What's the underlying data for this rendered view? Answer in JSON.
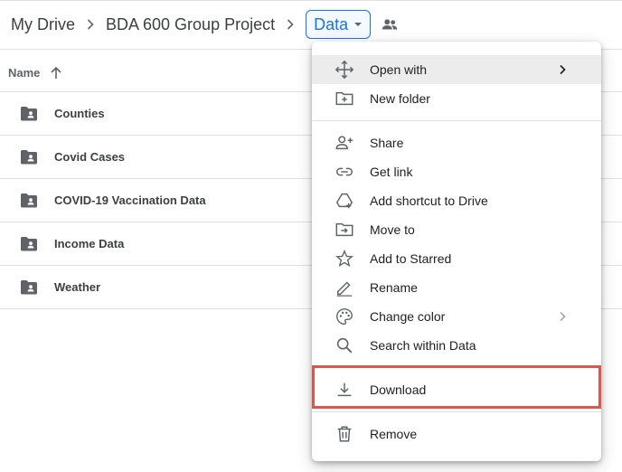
{
  "breadcrumb": {
    "root": "My Drive",
    "parent": "BDA 600 Group Project",
    "current": "Data"
  },
  "list": {
    "header_name": "Name",
    "sort_direction": "ascending",
    "folders": [
      "Counties",
      "Covid Cases",
      "COVID-19 Vaccination Data",
      "Income Data",
      "Weather"
    ]
  },
  "menu": {
    "items": {
      "open_with": "Open with",
      "new_folder": "New folder",
      "share": "Share",
      "get_link": "Get link",
      "add_shortcut": "Add shortcut to Drive",
      "move_to": "Move to",
      "add_starred": "Add to Starred",
      "rename": "Rename",
      "change_color": "Change color",
      "search_within": "Search within Data",
      "download": "Download",
      "remove": "Remove"
    }
  },
  "colors": {
    "accent": "#1a73e8",
    "highlight_border": "#d9584c",
    "icon": "#5f6368",
    "folder": "#5f6368"
  }
}
